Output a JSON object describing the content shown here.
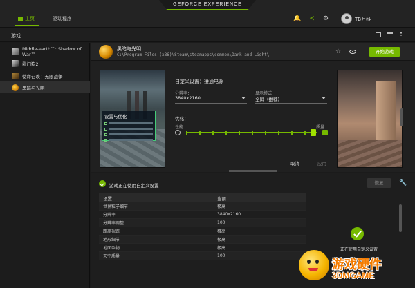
{
  "app": {
    "brand": "GEFORCE EXPERIENCE"
  },
  "nav": {
    "home_label": "主页",
    "drivers_label": "驱动程序",
    "username": "TB万科"
  },
  "sub_header": {
    "games_heading": "游戏"
  },
  "sidebar": {
    "items": [
      {
        "label": "Middle-earth™: Shadow of War™"
      },
      {
        "label": "看门狗2"
      },
      {
        "label": "使命召唤：无限战争"
      },
      {
        "label": "黑暗与光明"
      }
    ]
  },
  "game": {
    "title": "黑暗与光明",
    "path": "C:\\Program Files (x86)\\Steam\\steamapps\\common\\Dark and Light\\",
    "optimize_label": "开始游戏"
  },
  "settings": {
    "custom_setting": "自定义设置：接通电源",
    "resolution_label": "分辨率：",
    "resolution_value": "3840x2160",
    "display_mode_label": "显示模式：",
    "display_mode_value": "全屏（推荐）",
    "optimize_label": "优化：",
    "performance_label": "性能",
    "quality_label": "质量",
    "slider_position": 0.97,
    "cancel_label": "取消",
    "apply_label": "应用",
    "overlay_title": "设置与优化"
  },
  "status": {
    "text": "游戏正在使用自定义设置",
    "restore_label": "恢复",
    "done_text": "正在使用自定义设置"
  },
  "table": {
    "headers": [
      "设置",
      "当前"
    ],
    "rows": [
      [
        "世界粒子细节",
        "极高"
      ],
      [
        "分辨率",
        "3840x2160"
      ],
      [
        "分辨率调整",
        "100"
      ],
      [
        "距离视距",
        "极高"
      ],
      [
        "地形细节",
        "极高"
      ],
      [
        "地面杂物",
        "极高"
      ],
      [
        "天空质量",
        "100"
      ]
    ]
  },
  "watermark": {
    "title": "游戏硬件",
    "domain": "3DMGAME"
  },
  "colors": {
    "accent": "#76b900",
    "background": "#1b1b1b"
  }
}
